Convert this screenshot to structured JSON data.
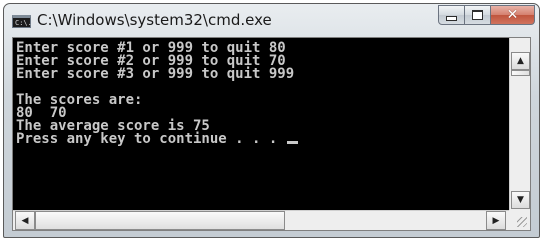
{
  "window": {
    "title": "C:\\Windows\\system32\\cmd.exe",
    "icon_label": "C:\\."
  },
  "console": {
    "lines": [
      "Enter score #1 or 999 to quit 80",
      "Enter score #2 or 999 to quit 70",
      "Enter score #3 or 999 to quit 999",
      "",
      "The scores are:",
      "80  70",
      "The average score is 75"
    ],
    "prompt_line": "Press any key to continue . . . "
  },
  "icons": {
    "app": "cmd-app-icon",
    "minimize": "minimize-icon",
    "maximize": "maximize-icon",
    "close": "close-icon",
    "scroll_up": "arrow-up-icon",
    "scroll_down": "arrow-down-icon",
    "scroll_left": "arrow-left-icon",
    "scroll_right": "arrow-right-icon"
  },
  "scrollbars": {
    "vertical_position": 0,
    "horizontal_position": 0
  },
  "colors": {
    "console_bg": "#000000",
    "console_fg": "#c8c8c8",
    "close_button": "#c9604a"
  }
}
